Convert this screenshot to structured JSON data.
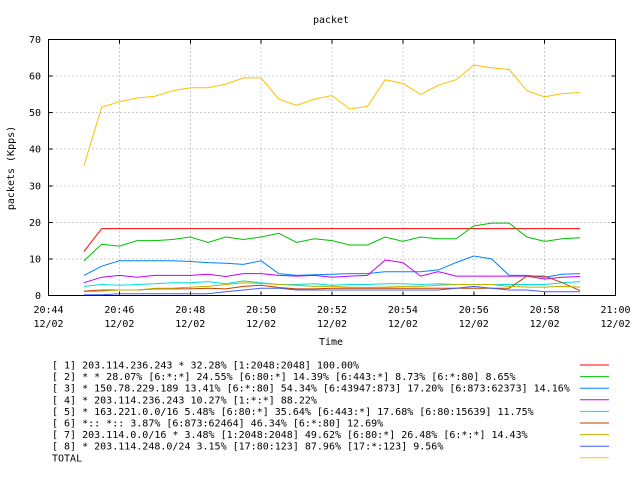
{
  "chart_data": {
    "type": "line",
    "title": "packet",
    "xlabel": "Time",
    "ylabel": "packets (Kpps)",
    "ylim": [
      0,
      70
    ],
    "yticks": [
      0,
      10,
      20,
      30,
      40,
      50,
      60,
      70
    ],
    "xlim": [
      "20:44",
      "21:00"
    ],
    "xtick_times": [
      "20:44",
      "20:46",
      "20:48",
      "20:50",
      "20:52",
      "20:54",
      "20:56",
      "20:58",
      "21:00"
    ],
    "xtick_dates": [
      "12/02",
      "12/02",
      "12/02",
      "12/02",
      "12/02",
      "12/02",
      "12/02",
      "12/02",
      "12/02"
    ],
    "grid": true,
    "legend_position": "bottom",
    "x": [
      "20:45",
      "20:45:30",
      "20:46",
      "20:46:30",
      "20:47",
      "20:47:30",
      "20:48",
      "20:48:30",
      "20:49",
      "20:49:30",
      "20:50",
      "20:50:30",
      "20:51",
      "20:51:30",
      "20:52",
      "20:52:30",
      "20:53",
      "20:53:30",
      "20:54",
      "20:54:30",
      "20:55",
      "20:55:30",
      "20:56",
      "20:56:30",
      "20:57",
      "20:57:30",
      "20:58",
      "20:58:30",
      "20:59"
    ],
    "series": [
      {
        "name": "[ 1] 203.114.236.243 * 32.28%  [1:2048:2048] 100.00%",
        "color": "#ff0000",
        "values": [
          12,
          18.3,
          18.3,
          18.3,
          18.3,
          18.3,
          18.3,
          18.3,
          18.3,
          18.3,
          18.3,
          18.3,
          18.3,
          18.3,
          18.3,
          18.3,
          18.3,
          18.3,
          18.3,
          18.3,
          18.3,
          18.3,
          18.3,
          18.3,
          18.3,
          18.3,
          18.3,
          18.3,
          18.3
        ]
      },
      {
        "name": "[ 2] * * 28.07%  [6:*:*] 24.55% [6:80:*] 14.39% [6:443:*] 8.73% [6:*:80] 8.65%",
        "color": "#00c000",
        "values": [
          9.5,
          14,
          13.5,
          15,
          15,
          15.3,
          16,
          14.5,
          16,
          15.3,
          16,
          17,
          14.5,
          15.5,
          15,
          13.8,
          13.8,
          16,
          14.8,
          16,
          15.5,
          15.5,
          19,
          19.8,
          19.8,
          16,
          14.8,
          15.5,
          15.8
        ]
      },
      {
        "name": "[ 3] * 150.78.229.189 13.41%  [6:*:80] 54.34% [6:43947:873] 17.20% [6:873:62373] 14.16%",
        "color": "#0080ff",
        "values": [
          5.5,
          8,
          9.5,
          9.5,
          9.5,
          9.5,
          9.3,
          9,
          8.8,
          8.5,
          9.5,
          6,
          5.5,
          5.7,
          5.8,
          6,
          6,
          6.5,
          6.5,
          6.5,
          7,
          9,
          10.8,
          10,
          5.5,
          5.5,
          5,
          5.8,
          6
        ]
      },
      {
        "name": "[ 4] * 203.114.236.243 10.27%  [1:*:*] 88.22%",
        "color": "#c000ff",
        "values": [
          3.5,
          5,
          5.5,
          5,
          5.5,
          5.5,
          5.5,
          5.8,
          5.2,
          6,
          6,
          5.5,
          5.3,
          5.5,
          5,
          5.3,
          5.5,
          9.7,
          9,
          5.3,
          6.5,
          5.3,
          5.3,
          5.3,
          5.3,
          5.3,
          4.5,
          5,
          5.2
        ]
      },
      {
        "name": "[ 5] * 163.221.0.0/16 5.48%  [6:80:*] 35.64% [6:443:*] 17.68% [6:80:15639] 11.75%",
        "color": "#00e0e0",
        "values": [
          2.5,
          3,
          2.8,
          3,
          3.2,
          3.5,
          3.5,
          3.8,
          3.2,
          4,
          3.5,
          3,
          3,
          3.2,
          2.8,
          3,
          3,
          3.2,
          3.2,
          3,
          3.2,
          3,
          3,
          3,
          3,
          3,
          3,
          3.5,
          3.8
        ]
      },
      {
        "name": "[ 6] *:: *:: 3.87%  [6:873:62464] 46.34% [6:*:80] 12.69%",
        "color": "#c04000",
        "values": [
          1.2,
          1.5,
          1.5,
          1.5,
          1.8,
          1.8,
          1.8,
          2,
          1.8,
          2.5,
          2.8,
          2.2,
          1.8,
          1.8,
          2,
          2,
          2,
          2,
          2,
          2,
          2,
          2,
          2,
          2,
          2,
          5.3,
          5.3,
          3.5,
          1.3
        ]
      },
      {
        "name": "[ 7] 203.114.0.0/16 * 3.48%  [1:2048:2048] 49.62% [6:80:*] 26.48% [6:*:*] 14.43%",
        "color": "#c0b000",
        "values": [
          1,
          1.2,
          1.5,
          1.5,
          2,
          2,
          2.3,
          2.5,
          3,
          3.5,
          3.3,
          3,
          2.8,
          2.5,
          2.5,
          2.3,
          2.2,
          2.3,
          2.5,
          2.5,
          2.8,
          3,
          3,
          3,
          2.5,
          2.3,
          2.3,
          2.5,
          2.3
        ]
      },
      {
        "name": "[ 8] * 203.114.248.0/24 3.15%  [17:80:123] 87.96% [17:*:123] 9.56%",
        "color": "#4060ff",
        "values": [
          0.2,
          0.2,
          0.5,
          0.5,
          0.5,
          0.5,
          0.5,
          0.5,
          1,
          1.5,
          2,
          2,
          1.5,
          1.5,
          1.5,
          1.5,
          1.5,
          1.5,
          1.5,
          1.5,
          1.5,
          2,
          2.5,
          2,
          1.5,
          1.5,
          1,
          1,
          1
        ]
      },
      {
        "name": "TOTAL",
        "color": "#ffc000",
        "values": [
          35.5,
          51.5,
          53,
          54,
          54.5,
          56,
          56.8,
          56.8,
          57.8,
          59.5,
          59.5,
          53.7,
          52,
          53.7,
          54.7,
          51,
          51.7,
          59,
          58,
          55,
          57.5,
          59,
          63,
          62.3,
          61.8,
          56,
          54.3,
          55.2,
          55.5
        ]
      }
    ]
  }
}
